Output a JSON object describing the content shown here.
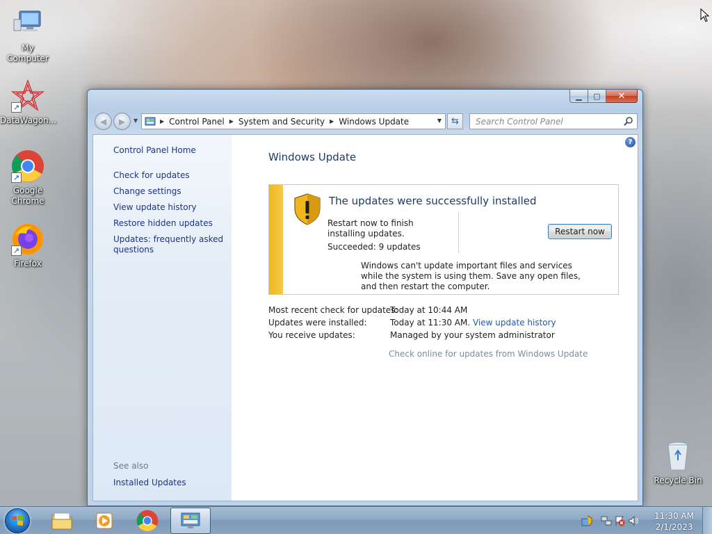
{
  "desktop": {
    "icons": [
      {
        "label": "My Computer",
        "icon": "computer-icon"
      },
      {
        "label": "DataWagon...",
        "icon": "datawagon-icon"
      },
      {
        "label": "Google Chrome",
        "icon": "chrome-icon"
      },
      {
        "label": "Firefox",
        "icon": "firefox-icon"
      },
      {
        "label": "Recycle Bin",
        "icon": "recycle-bin-icon"
      }
    ]
  },
  "window": {
    "breadcrumb": [
      "Control Panel",
      "System and Security",
      "Windows Update"
    ],
    "search_placeholder": "Search Control Panel",
    "left_nav": {
      "home": "Control Panel Home",
      "items": [
        "Check for updates",
        "Change settings",
        "View update history",
        "Restore hidden updates",
        "Updates: frequently asked questions"
      ],
      "see_also_label": "See also",
      "see_also_items": [
        "Installed Updates"
      ]
    },
    "main": {
      "title": "Windows Update",
      "status": {
        "heading": "The updates were successfully installed",
        "message": "Restart now to finish installing updates.",
        "succeeded": "Succeeded: 9 updates",
        "button": "Restart now",
        "note": "Windows can't update important files and services while the system is using them. Save any open files, and then restart the computer."
      },
      "info": [
        {
          "label": "Most recent check for updates:",
          "value": "Today at 10:44 AM",
          "link": ""
        },
        {
          "label": "Updates were installed:",
          "value": "Today at 11:30 AM.",
          "link": "View update history"
        },
        {
          "label": "You receive updates:",
          "value": "Managed by your system administrator",
          "link": ""
        }
      ],
      "check_online": "Check online for updates from Windows Update"
    }
  },
  "taskbar": {
    "clock_time": "11:30 AM",
    "clock_date": "2/1/2023"
  },
  "colors": {
    "status_accent": "#f0b71c",
    "link": "#1e3287",
    "title": "#1e3a66"
  }
}
